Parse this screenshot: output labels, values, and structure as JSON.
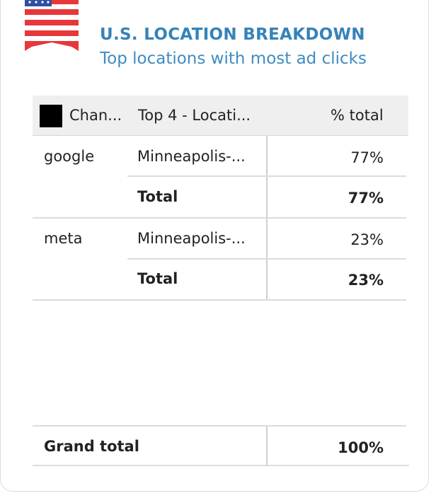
{
  "header": {
    "title": "U.S. LOCATION BREAKDOWN",
    "subtitle": "Top locations with most ad clicks",
    "flag_icon": "us-flag-ribbon-icon"
  },
  "table": {
    "columns": [
      "Chan...",
      "Top 4 - Locati...",
      "% total"
    ],
    "groups": [
      {
        "channel": "google",
        "location": "Minneapolis-...",
        "percent": "77%",
        "total_label": "Total",
        "total_value": "77%"
      },
      {
        "channel": "meta",
        "location": "Minneapolis-...",
        "percent": "23%",
        "total_label": "Total",
        "total_value": "23%"
      }
    ],
    "grand_total_label": "Grand total",
    "grand_total_value": "100%"
  },
  "colors": {
    "title": "#3583b8",
    "header_bg": "#efefef",
    "flag_red": "#e8373a",
    "flag_blue": "#2f4fa2"
  }
}
